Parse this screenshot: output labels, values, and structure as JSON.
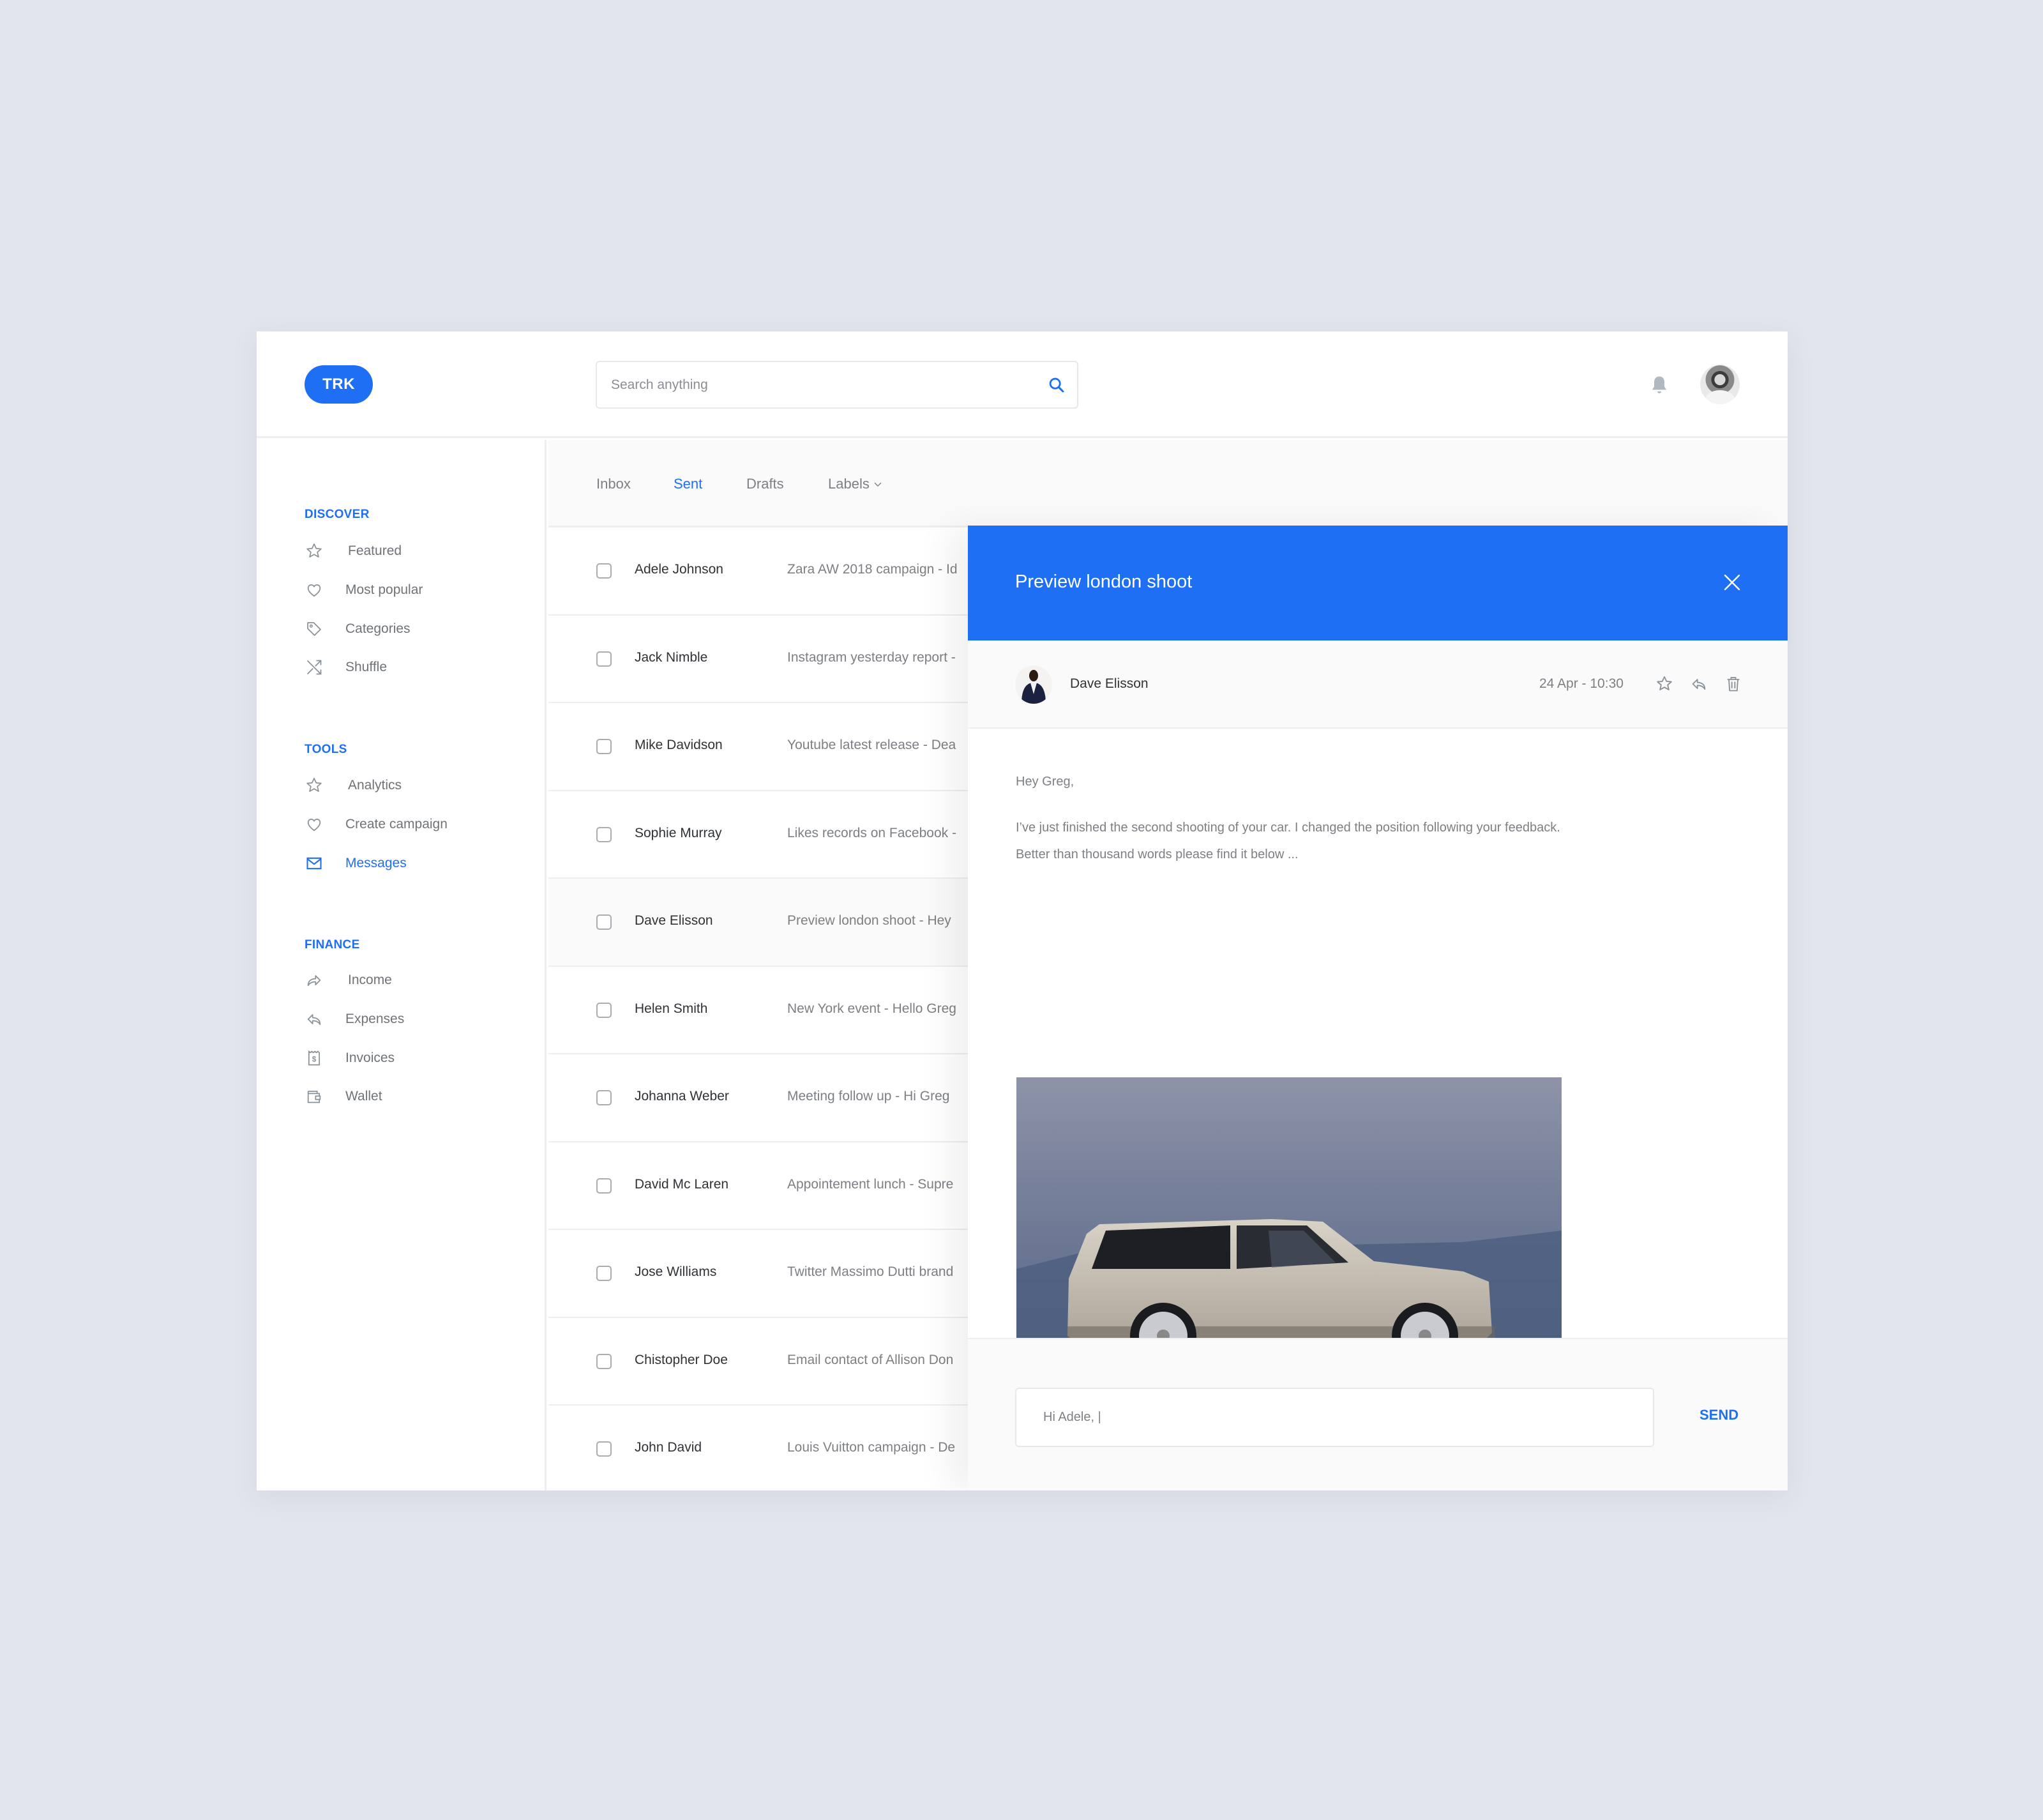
{
  "header": {
    "logo_text": "TRK",
    "search_placeholder": "Search anything",
    "search_icon": "search-icon",
    "notification_icon": "bell-icon",
    "avatar": "user-avatar"
  },
  "sidebar": {
    "sections": [
      {
        "title": "DISCOVER",
        "items": [
          {
            "label": "Featured",
            "icon": "star-icon",
            "active": false
          },
          {
            "label": "Most popular",
            "icon": "heart-icon",
            "active": false
          },
          {
            "label": "Categories",
            "icon": "tag-icon",
            "active": false
          },
          {
            "label": "Shuffle",
            "icon": "shuffle-icon",
            "active": false
          }
        ]
      },
      {
        "title": "TOOLS",
        "items": [
          {
            "label": "Analytics",
            "icon": "star-icon",
            "active": false
          },
          {
            "label": "Create campaign",
            "icon": "heart-icon",
            "active": false
          },
          {
            "label": "Messages",
            "icon": "envelope-icon",
            "active": true
          }
        ]
      },
      {
        "title": "FINANCE",
        "items": [
          {
            "label": "Income",
            "icon": "forward-arrow-icon",
            "active": false
          },
          {
            "label": "Expenses",
            "icon": "reply-arrow-icon",
            "active": false
          },
          {
            "label": "Invoices",
            "icon": "receipt-icon",
            "active": false
          },
          {
            "label": "Wallet",
            "icon": "wallet-icon",
            "active": false
          }
        ]
      }
    ]
  },
  "tabs": [
    {
      "label": "Inbox",
      "active": false
    },
    {
      "label": "Sent",
      "active": true
    },
    {
      "label": "Drafts",
      "active": false
    },
    {
      "label": "Labels",
      "active": false,
      "dropdown": true
    }
  ],
  "messages": [
    {
      "name": "Adele Johnson",
      "subject": "Zara AW 2018 campaign - Id",
      "checked": false,
      "selected": false
    },
    {
      "name": "Jack Nimble",
      "subject": "Instagram yesterday report -",
      "checked": false,
      "selected": false
    },
    {
      "name": "Mike Davidson",
      "subject": "Youtube latest release - Dea",
      "checked": false,
      "selected": false
    },
    {
      "name": "Sophie Murray",
      "subject": "Likes records on Facebook -",
      "checked": false,
      "selected": false
    },
    {
      "name": "Dave Elisson",
      "subject": "Preview london shoot - Hey",
      "checked": false,
      "selected": true
    },
    {
      "name": "Helen Smith",
      "subject": "New York event - Hello Greg",
      "checked": false,
      "selected": false
    },
    {
      "name": "Johanna Weber",
      "subject": "Meeting follow up  - Hi Greg",
      "checked": false,
      "selected": false
    },
    {
      "name": "David Mc Laren",
      "subject": "Appointement lunch - Supre",
      "checked": false,
      "selected": false
    },
    {
      "name": "Jose Williams",
      "subject": "Twitter Massimo Dutti brand",
      "checked": false,
      "selected": false
    },
    {
      "name": "Chistopher Doe",
      "subject": "Email contact of Allison Don",
      "checked": false,
      "selected": false
    },
    {
      "name": "John David",
      "subject": "Louis Vuitton campaign - De",
      "checked": false,
      "selected": false
    }
  ],
  "preview": {
    "title": "Preview london shoot",
    "close_icon": "close-icon",
    "sender": "Dave Elisson",
    "date": "24 Apr - 10:30",
    "actions": [
      "star-icon",
      "reply-icon",
      "trash-icon"
    ],
    "body": [
      "Hey Greg,",
      "I’ve just finished the second shooting of your car. I changed the position following your feedback.",
      "Better than thousand words please find it below ..."
    ],
    "attachment": "car-photo",
    "reply_value": "Hi Adele, |",
    "send_label": "SEND"
  },
  "colors": {
    "accent": "#1f6ff5",
    "background": "#e2e5ed",
    "text_primary": "#2f3236",
    "text_secondary": "#7c7f84"
  }
}
